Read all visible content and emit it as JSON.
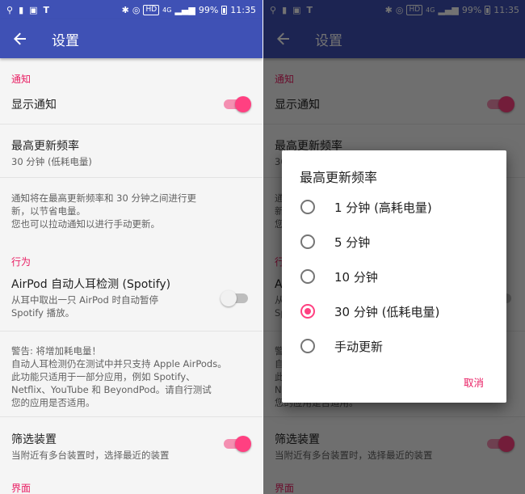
{
  "status_bar": {
    "hd": "HD",
    "net_4g": "4G",
    "battery": "99%",
    "time": "11:35"
  },
  "toolbar": {
    "title": "设置"
  },
  "sections": {
    "notifications": {
      "header": "通知",
      "show_notification": {
        "title": "显示通知",
        "checked": true
      },
      "max_update_freq": {
        "title": "最高更新频率",
        "summary": "30 分钟 (低耗电量)"
      },
      "note_lines": [
        "通知将在最高更新频率和 30 分钟之间进行更",
        "新，以节省电量。",
        "您也可以拉动通知以进行手动更新。"
      ]
    },
    "behavior": {
      "header": "行为",
      "ear_detection": {
        "title": "AirPod 自动人耳检测 (Spotify)",
        "summary_lines": [
          "从耳中取出一只 AirPod 时自动暂停",
          "Spotify 播放。"
        ],
        "checked": false
      },
      "warning_lines": [
        "警告: 将增加耗电量！",
        "自动人耳检测仍在测试中并只支持 Apple AirPods。",
        "此功能只适用于一部分应用，例如 Spotify、",
        "Netflix、YouTube 和 BeyondPod。请自行测试",
        "您的应用是否适用。"
      ],
      "filter_device": {
        "title": "筛选装置",
        "summary": "当附近有多台装置时，选择最近的装置",
        "checked": true
      }
    },
    "interface": {
      "header": "界面"
    }
  },
  "dialog": {
    "title": "最高更新频率",
    "options": [
      {
        "label": "1 分钟 (高耗电量)",
        "selected": false
      },
      {
        "label": "5 分钟",
        "selected": false
      },
      {
        "label": "10 分钟",
        "selected": false
      },
      {
        "label": "30 分钟 (低耗电量)",
        "selected": true
      },
      {
        "label": "手动更新",
        "selected": false
      }
    ],
    "cancel": "取消"
  },
  "colors": {
    "primary": "#3f51b5",
    "accent": "#ff4081",
    "category": "#e91e63"
  },
  "icons": [
    "back-arrow-icon",
    "usb-icon",
    "lock-icon",
    "image-icon",
    "t-icon",
    "bluetooth-icon",
    "alarm-icon",
    "signal-icon",
    "battery-icon"
  ]
}
